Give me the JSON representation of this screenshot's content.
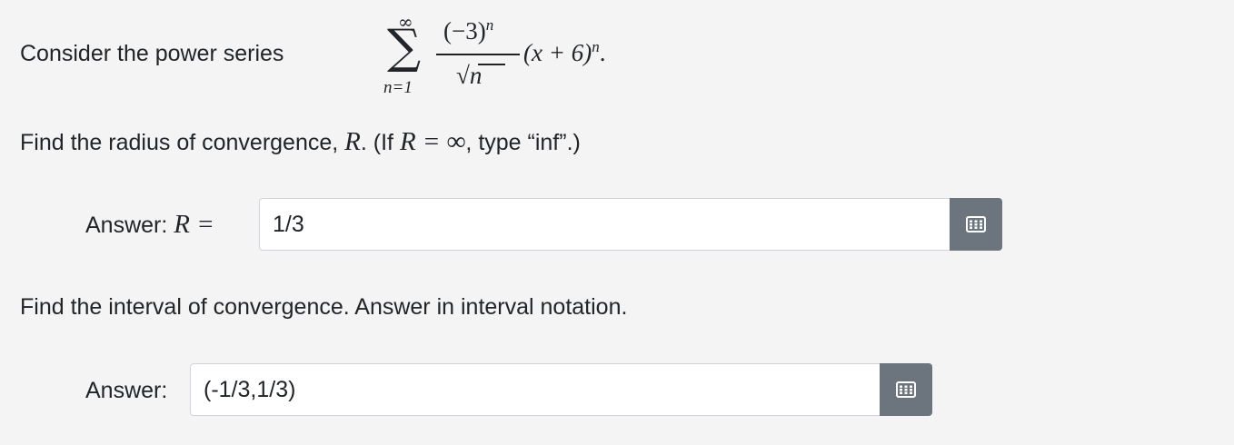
{
  "question": {
    "intro": "Consider the power series",
    "series": {
      "upper_limit": "∞",
      "lower_limit": "n=1",
      "numerator_base": "(−3)",
      "numerator_exp": "n",
      "denominator": "n",
      "tail_base": "(x + 6)",
      "tail_exp": "n",
      "tail_end": "."
    }
  },
  "part1": {
    "prompt_before": "Find the radius of convergence,",
    "prompt_var": "R",
    "prompt_mid": ". (If",
    "prompt_eq": "R = ∞",
    "prompt_after": ", type “inf”.)",
    "answer_label": "Answer:",
    "answer_var": "R =",
    "answer_value": "1/3",
    "keypad_icon": "keyboard-grid-icon"
  },
  "part2": {
    "prompt": "Find the interval of convergence. Answer in interval notation.",
    "answer_label": "Answer:",
    "answer_value": "(-1/3,1/3)",
    "keypad_icon": "keyboard-grid-icon"
  },
  "colors": {
    "background": "#f4f4f4",
    "button": "#6c757d",
    "input_border": "#ced4da"
  }
}
